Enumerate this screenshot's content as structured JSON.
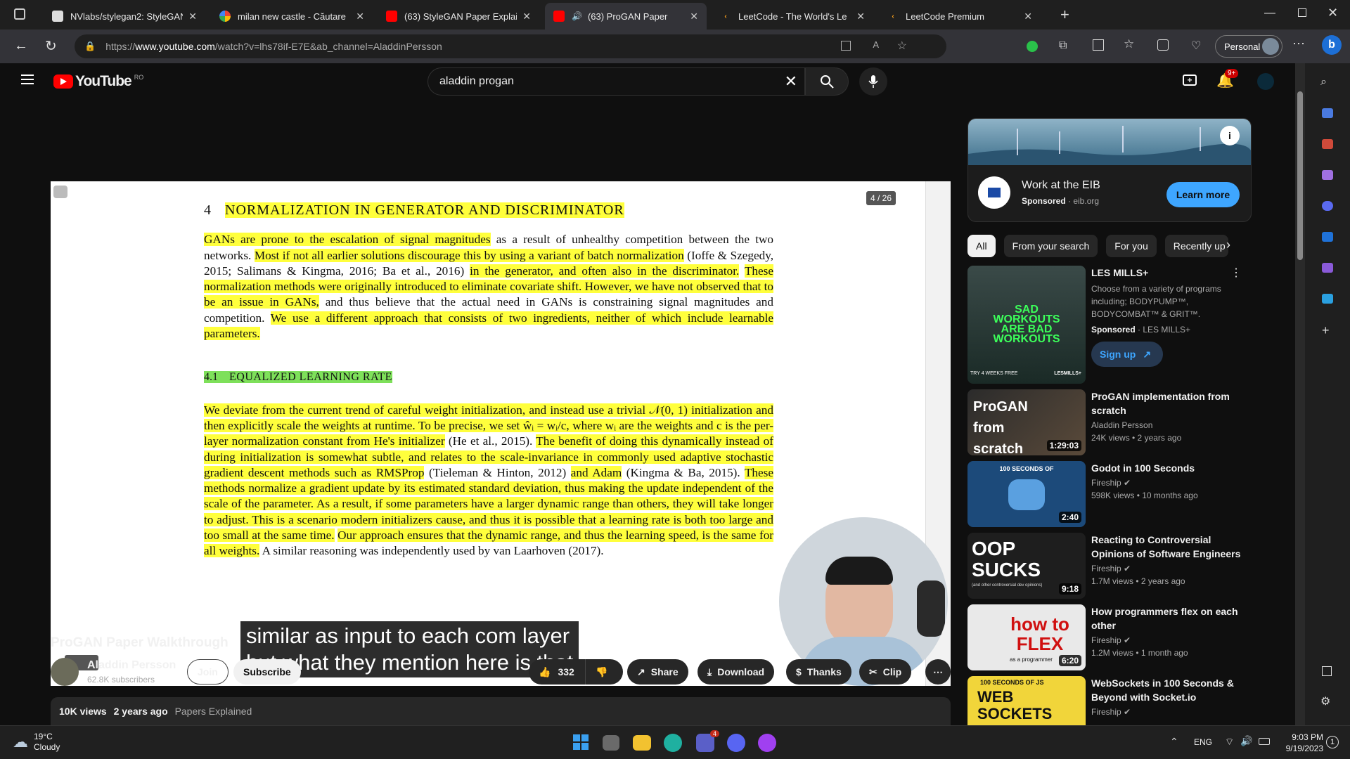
{
  "tabs": [
    {
      "title": "NVlabs/stylegan2: StyleGAN",
      "fav": "github-icon"
    },
    {
      "title": "milan new castle - Căutare",
      "fav": "google-icon"
    },
    {
      "title": "(63) StyleGAN Paper Explain",
      "fav": "youtube-icon"
    },
    {
      "title": "(63) ProGAN Paper",
      "fav": "youtube-icon",
      "active": true
    },
    {
      "title": "LeetCode - The World's Le",
      "fav": "leetcode-icon"
    },
    {
      "title": "LeetCode Premium",
      "fav": "leetcode-icon"
    }
  ],
  "address": {
    "prefix": "https://",
    "host": "www.youtube.com",
    "path": "/watch?v=lhs78if-E7E&ab_channel=AladdinPersson"
  },
  "profile": {
    "label": "Personal"
  },
  "youtube": {
    "logo_text": "YouTube",
    "region": "RO",
    "search_value": "aladdin progan",
    "notifications": "9+"
  },
  "paper": {
    "page_indicator": "4 / 26",
    "section_num": "4",
    "section_title": "NORMALIZATION IN GENERATOR AND DISCRIMINATOR",
    "para1": [
      {
        "t": "GANs are prone to the escalation of signal magnitudes",
        "h": true
      },
      {
        "t": " as a result of unhealthy competition between the two networks. ",
        "h": false
      },
      {
        "t": "Most if not all earlier solutions discourage this by using a variant of batch normalization",
        "h": true
      },
      {
        "t": " (Ioffe & Szegedy, 2015; Salimans & Kingma, 2016; Ba et al., 2016) ",
        "h": false
      },
      {
        "t": "in the generator, and often also in the discriminator.",
        "h": true
      },
      {
        "t": " ",
        "h": false
      },
      {
        "t": "These normalization methods were originally introduced to eliminate covariate shift. However, we have not observed that to be an issue in GANs,",
        "h": true
      },
      {
        "t": " and thus believe that the actual need in GANs is constraining signal magnitudes and competition. ",
        "h": false
      },
      {
        "t": "We use a different approach that consists of two ingredients, neither of which include learnable parameters.",
        "h": true
      }
    ],
    "subsection_num": "4.1",
    "subsection_title": "EQUALIZED LEARNING RATE",
    "para2": [
      {
        "t": "We deviate from the current trend of careful weight initialization, and instead use a trivial 𝒩(0, 1) initialization and then explicitly scale the weights at runtime. To be precise, we set ŵᵢ = wᵢ/c, where wᵢ are the weights and c is the per-layer normalization constant from He's initializer",
        "h": true
      },
      {
        "t": " (He et al., 2015). ",
        "h": false
      },
      {
        "t": "The benefit of doing this dynamically instead of during initialization is somewhat subtle, and relates to the scale-invariance in commonly used adaptive stochastic gradient descent methods such as RMSProp",
        "h": true
      },
      {
        "t": " (Tieleman & Hinton, 2012) ",
        "h": false
      },
      {
        "t": "and Adam",
        "h": true
      },
      {
        "t": " (Kingma & Ba, 2015). ",
        "h": false
      },
      {
        "t": "These methods normalize a gradient update by its estimated standard deviation, thus making the update independent of the scale of the parameter. As a result, if some parameters have a larger dynamic range than others, they will take longer to adjust. This is a scenario modern initializers cause, and thus it is possible that a learning rate is both too large and too small at the same time.",
        "h": true
      },
      {
        "t": " ",
        "h": false
      },
      {
        "t": "Our approach ensures that the dynamic range, and thus the learning speed, is the same for all weights.",
        "h": true
      },
      {
        "t": " A similar reasoning was independently used by van Laarhoven (2017).",
        "h": false
      }
    ]
  },
  "caption": {
    "line1": "similar as input to each com layer",
    "line2": "but what they mention here is that"
  },
  "video": {
    "title": "ProGAN Paper Walkthrough",
    "channel": "Aladdin Persson",
    "subscribers": "62.8K subscribers",
    "join": "Join",
    "subscribe": "Subscribe",
    "likes": "332",
    "share": "Share",
    "download": "Download",
    "thanks": "Thanks",
    "clip": "Clip",
    "views": "10K views",
    "age": "2 years ago",
    "playlist": "Papers Explained"
  },
  "ad": {
    "title": "Work at the EIB",
    "sponsored": "Sponsored",
    "domain": "eib.org",
    "cta": "Learn more"
  },
  "chips": [
    "All",
    "From your search",
    "For you",
    "Recently up"
  ],
  "sponsored_rec": {
    "title": "LES MILLS+",
    "desc": "Choose from a variety of programs including; BODYPUMP™, BODYCOMBAT™ & GRIT™.",
    "sponsored": "Sponsored",
    "advertiser": "LES MILLS+",
    "cta": "Sign up",
    "thumb_text": "SAD WORKOUTS ARE BAD WORKOUTS",
    "thumb_small": "TRY 4 WEEKS FREE",
    "thumb_brand": "LESMILLS+"
  },
  "recommendations": [
    {
      "title": "ProGAN implementation from scratch",
      "channel": "Aladdin Persson",
      "verified": false,
      "meta": "24K views • 2 years ago",
      "duration": "1:29:03",
      "thumb_text": "ProGAN from scratch"
    },
    {
      "title": "Godot in 100 Seconds",
      "channel": "Fireship",
      "verified": true,
      "meta": "598K views • 10 months ago",
      "duration": "2:40",
      "thumb_text": "100 SECONDS OF"
    },
    {
      "title": "Reacting to Controversial Opinions of Software Engineers",
      "channel": "Fireship",
      "verified": true,
      "meta": "1.7M views • 2 years ago",
      "duration": "9:18",
      "thumb_text": "OOP SUCKS",
      "thumb_small": "(and other controversial dev opinions)"
    },
    {
      "title": "How programmers flex on each other",
      "channel": "Fireship",
      "verified": true,
      "meta": "1.2M views • 1 month ago",
      "duration": "6:20",
      "thumb_text": "how to FLEX",
      "thumb_small": "as a programmer"
    },
    {
      "title": "WebSockets in 100 Seconds & Beyond with Socket.io",
      "channel": "Fireship",
      "verified": true,
      "meta": "",
      "duration": "",
      "thumb_text": "WEB SOCKETS",
      "thumb_small": "100 SECONDS OF JS"
    }
  ],
  "taskbar": {
    "temp": "19°C",
    "weather": "Cloudy",
    "lang": "ENG",
    "time": "9:03 PM",
    "date": "9/19/2023",
    "teams_badge": "4",
    "notif_count": "1"
  },
  "colors": {
    "yt_red": "#ff0000",
    "highlight": "#ffff3c",
    "highlight_green": "#7ee05a",
    "ad_blue": "#3ea6ff"
  }
}
